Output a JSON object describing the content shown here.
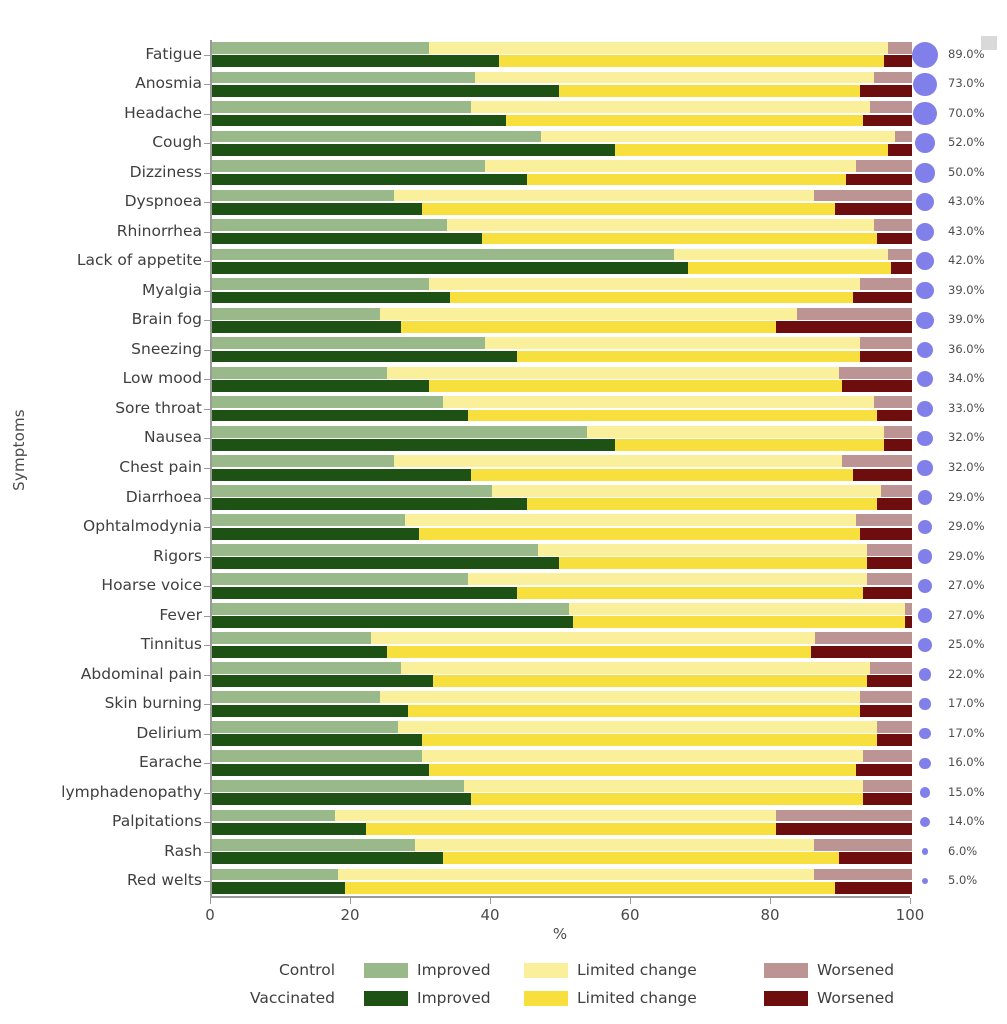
{
  "chart_data": {
    "type": "bar",
    "orientation": "horizontal",
    "stacked": true,
    "title": "",
    "xlabel": "%",
    "ylabel": "Symptoms",
    "xlim": [
      0,
      100
    ],
    "xticks": [
      0,
      20,
      40,
      60,
      80,
      100
    ],
    "grid": false,
    "legend_position": "bottom",
    "categories": [
      "Fatigue",
      "Anosmia",
      "Headache",
      "Cough",
      "Dizziness",
      "Dyspnoea",
      "Rhinorrhea",
      "Lack of appetite",
      "Myalgia",
      "Brain fog",
      "Sneezing",
      "Low mood",
      "Sore throat",
      "Nausea",
      "Chest pain",
      "Diarrhoea",
      "Ophtalmodynia",
      "Rigors",
      "Hoarse voice",
      "Fever",
      "Tinnitus",
      "Abdominal pain",
      "Skin burning",
      "Delirium",
      "Earache",
      "lymphadenopathy",
      "Palpitations",
      "Rash",
      "Red welts"
    ],
    "prevalence_labels": [
      "89.0%",
      "73.0%",
      "70.0%",
      "52.0%",
      "50.0%",
      "43.0%",
      "43.0%",
      "42.0%",
      "39.0%",
      "39.0%",
      "36.0%",
      "34.0%",
      "33.0%",
      "32.0%",
      "32.0%",
      "29.0%",
      "29.0%",
      "29.0%",
      "27.0%",
      "27.0%",
      "25.0%",
      "22.0%",
      "17.0%",
      "17.0%",
      "16.0%",
      "15.0%",
      "14.0%",
      "6.0%",
      "5.0%"
    ],
    "prevalence_values": [
      89,
      73,
      70,
      52,
      50,
      43,
      43,
      42,
      39,
      39,
      36,
      34,
      33,
      32,
      32,
      29,
      29,
      29,
      27,
      27,
      25,
      22,
      17,
      17,
      16,
      15,
      14,
      6,
      5
    ],
    "series": [
      {
        "group": "Control",
        "segments": [
          {
            "name": "Improved",
            "color": "#9ab98a",
            "values": [
              31.0,
              37.5,
              37.0,
              47.0,
              39.0,
              26.0,
              33.5,
              66.0,
              31.0,
              24.0,
              39.0,
              25.0,
              33.0,
              53.5,
              26.0,
              40.0,
              27.5,
              46.5,
              36.5,
              51.0,
              23.0,
              27.0,
              24.0,
              26.5,
              30.0,
              36.0,
              17.5,
              29.0,
              18.0
            ]
          },
          {
            "name": "Limited change",
            "color": "#faf09b",
            "values": [
              65.5,
              57.0,
              57.0,
              50.5,
              53.0,
              60.0,
              61.0,
              30.5,
              61.5,
              59.5,
              53.5,
              64.5,
              61.5,
              42.5,
              64.0,
              55.5,
              64.5,
              47.0,
              57.0,
              48.0,
              64.0,
              67.0,
              68.5,
              68.5,
              63.0,
              57.0,
              63.0,
              57.0,
              68.0
            ]
          },
          {
            "name": "Worsened",
            "color": "#bd9494",
            "values": [
              3.5,
              5.5,
              6.0,
              2.5,
              8.0,
              14.0,
              5.5,
              3.5,
              7.5,
              16.5,
              7.5,
              10.5,
              5.5,
              4.0,
              10.0,
              4.5,
              8.0,
              6.5,
              6.5,
              1.0,
              14.0,
              6.0,
              7.5,
              5.0,
              7.0,
              7.0,
              19.5,
              14.0,
              14.0
            ]
          }
        ]
      },
      {
        "group": "Vaccinated",
        "segments": [
          {
            "name": "Improved",
            "color": "#1e5214",
            "values": [
              41.0,
              49.5,
              42.0,
              57.5,
              45.0,
              30.0,
              38.5,
              68.0,
              34.0,
              27.0,
              43.5,
              31.0,
              36.5,
              57.5,
              37.0,
              45.0,
              29.5,
              49.5,
              43.5,
              51.5,
              25.0,
              31.5,
              28.0,
              30.0,
              31.0,
              37.0,
              22.0,
              33.0,
              19.0
            ]
          },
          {
            "name": "Limited change",
            "color": "#f7e03d",
            "values": [
              55.0,
              43.0,
              51.0,
              39.0,
              45.5,
              59.0,
              56.5,
              29.0,
              57.5,
              53.5,
              49.0,
              59.0,
              58.5,
              38.5,
              54.5,
              50.0,
              63.0,
              44.0,
              49.5,
              47.5,
              60.5,
              62.0,
              64.5,
              65.0,
              61.0,
              56.0,
              58.5,
              56.5,
              70.0
            ]
          },
          {
            "name": "Worsened",
            "color": "#6e0d0d",
            "values": [
              4.0,
              7.5,
              7.0,
              3.5,
              9.5,
              11.0,
              5.0,
              3.0,
              8.5,
              19.5,
              7.5,
              10.0,
              5.0,
              4.0,
              8.5,
              5.0,
              7.5,
              6.5,
              7.0,
              1.0,
              14.5,
              6.5,
              7.5,
              5.0,
              8.0,
              7.0,
              19.5,
              10.5,
              11.0
            ]
          }
        ]
      }
    ]
  },
  "legend": {
    "rows": [
      {
        "group_label": "Control",
        "entries": [
          {
            "label": "Improved",
            "color": "#9ab98a"
          },
          {
            "label": "Limited change",
            "color": "#faf09b"
          },
          {
            "label": "Worsened",
            "color": "#bd9494"
          }
        ]
      },
      {
        "group_label": "Vaccinated",
        "entries": [
          {
            "label": "Improved",
            "color": "#1e5214"
          },
          {
            "label": "Limited change",
            "color": "#f7e03d"
          },
          {
            "label": "Worsened",
            "color": "#6e0d0d"
          }
        ]
      }
    ]
  },
  "axes": {
    "x_label": "%",
    "y_label": "Symptoms",
    "x_tick_labels": [
      "0",
      "20",
      "40",
      "60",
      "80",
      "100"
    ]
  },
  "annotation": {
    "marker_color": "#6f6ee8",
    "marker_name": "prevalence-dot"
  }
}
